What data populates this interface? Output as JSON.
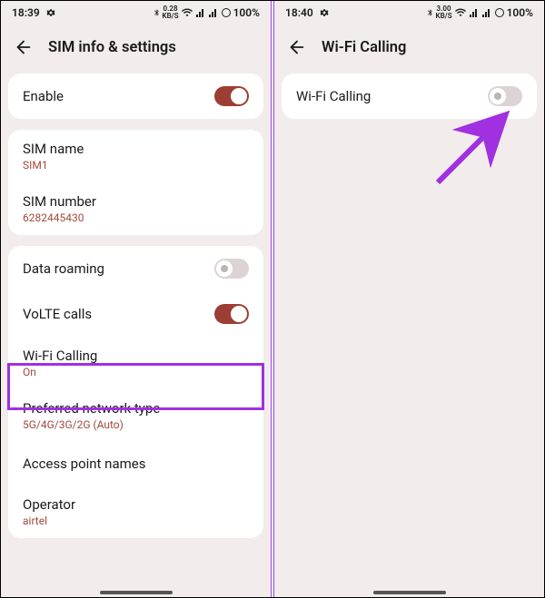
{
  "left": {
    "status": {
      "time": "18:39",
      "net": "0.28",
      "netunit": "KB/S",
      "battery": "100%"
    },
    "header": {
      "title": "SIM info & settings"
    },
    "card1": {
      "enable": {
        "label": "Enable",
        "on": true
      }
    },
    "card2": {
      "simname": {
        "label": "SIM name",
        "value": "SIM1"
      },
      "simnumber": {
        "label": "SIM number",
        "value": "6282445430"
      }
    },
    "card3": {
      "roaming": {
        "label": "Data roaming",
        "on": false
      },
      "volte": {
        "label": "VoLTE calls",
        "on": true
      },
      "wificalling": {
        "label": "Wi-Fi Calling",
        "value": "On"
      },
      "prefnet": {
        "label": "Preferred network type",
        "value": "5G/4G/3G/2G (Auto)"
      },
      "apn": {
        "label": "Access point names"
      },
      "operator": {
        "label": "Operator",
        "value": "airtel"
      }
    }
  },
  "right": {
    "status": {
      "time": "18:40",
      "net": "3.00",
      "netunit": "KB/S",
      "battery": "100%"
    },
    "header": {
      "title": "Wi-Fi Calling"
    },
    "row": {
      "label": "Wi-Fi Calling",
      "on": false
    }
  }
}
